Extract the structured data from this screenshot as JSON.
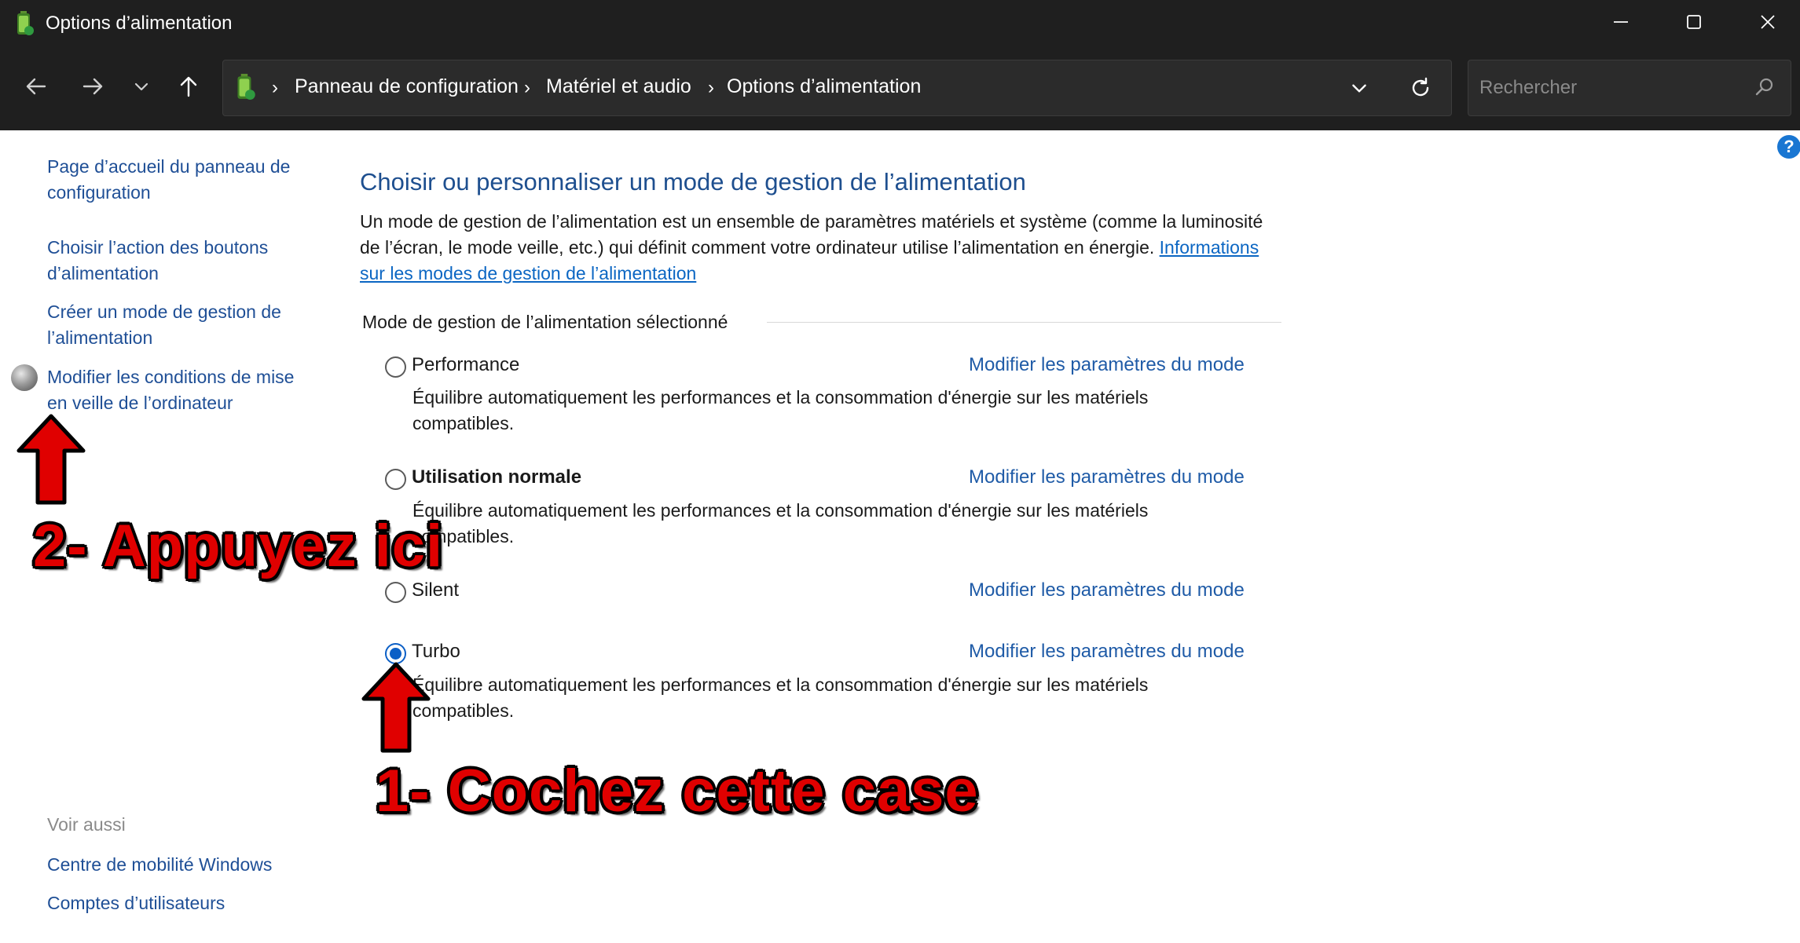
{
  "window": {
    "title": "Options d’alimentation",
    "minimize_icon": "minimize-icon",
    "maximize_icon": "maximize-icon",
    "close_icon": "close-icon"
  },
  "nav": {
    "breadcrumbs": [
      "Panneau de configuration",
      "Matériel et audio",
      "Options d’alimentation"
    ],
    "separator": "›",
    "search_placeholder": "Rechercher"
  },
  "sidebar": {
    "links": [
      "Page d’accueil du panneau de configuration",
      "Choisir l’action des boutons d’alimentation",
      "Créer un mode de gestion de l’alimentation",
      "Modifier les conditions de mise en veille de l’ordinateur"
    ],
    "see_also_label": "Voir aussi",
    "see_also": [
      "Centre de mobilité Windows",
      "Comptes d’utilisateurs"
    ]
  },
  "main": {
    "title": "Choisir ou personnaliser un mode de gestion de l’alimentation",
    "description": "Un mode de gestion de l’alimentation est un ensemble de paramètres matériels et système (comme la luminosité de l’écran, le mode veille, etc.) qui définit comment votre ordinateur utilise l’alimentation en énergie.",
    "info_link": "Informations sur les modes de gestion de l’alimentation",
    "section_label": "Mode de gestion de l’alimentation sélectionné",
    "plans": [
      {
        "name": "Performance",
        "bold": false,
        "checked": false,
        "link": "Modifier les paramètres du mode",
        "desc": "Équilibre automatiquement les performances et la consommation d'énergie sur les matériels compatibles."
      },
      {
        "name": "Utilisation normale",
        "bold": true,
        "checked": false,
        "link": "Modifier les paramètres du mode",
        "desc": "Équilibre automatiquement les performances et la consommation d'énergie sur les matériels compatibles."
      },
      {
        "name": "Silent",
        "bold": false,
        "checked": false,
        "link": "Modifier les paramètres du mode",
        "desc": ""
      },
      {
        "name": "Turbo",
        "bold": false,
        "checked": true,
        "link": "Modifier les paramètres du mode",
        "desc": "Équilibre automatiquement les performances et la consommation d'énergie sur les matériels compatibles."
      }
    ]
  },
  "annotations": {
    "step1": "1-  Cochez cette case",
    "step2": "2- Appuyez ici",
    "color": "#e00000"
  },
  "colors": {
    "titlebar_bg": "#1f1f1f",
    "link_blue": "#1f5ba7",
    "radio_blue": "#0b5fc6"
  }
}
